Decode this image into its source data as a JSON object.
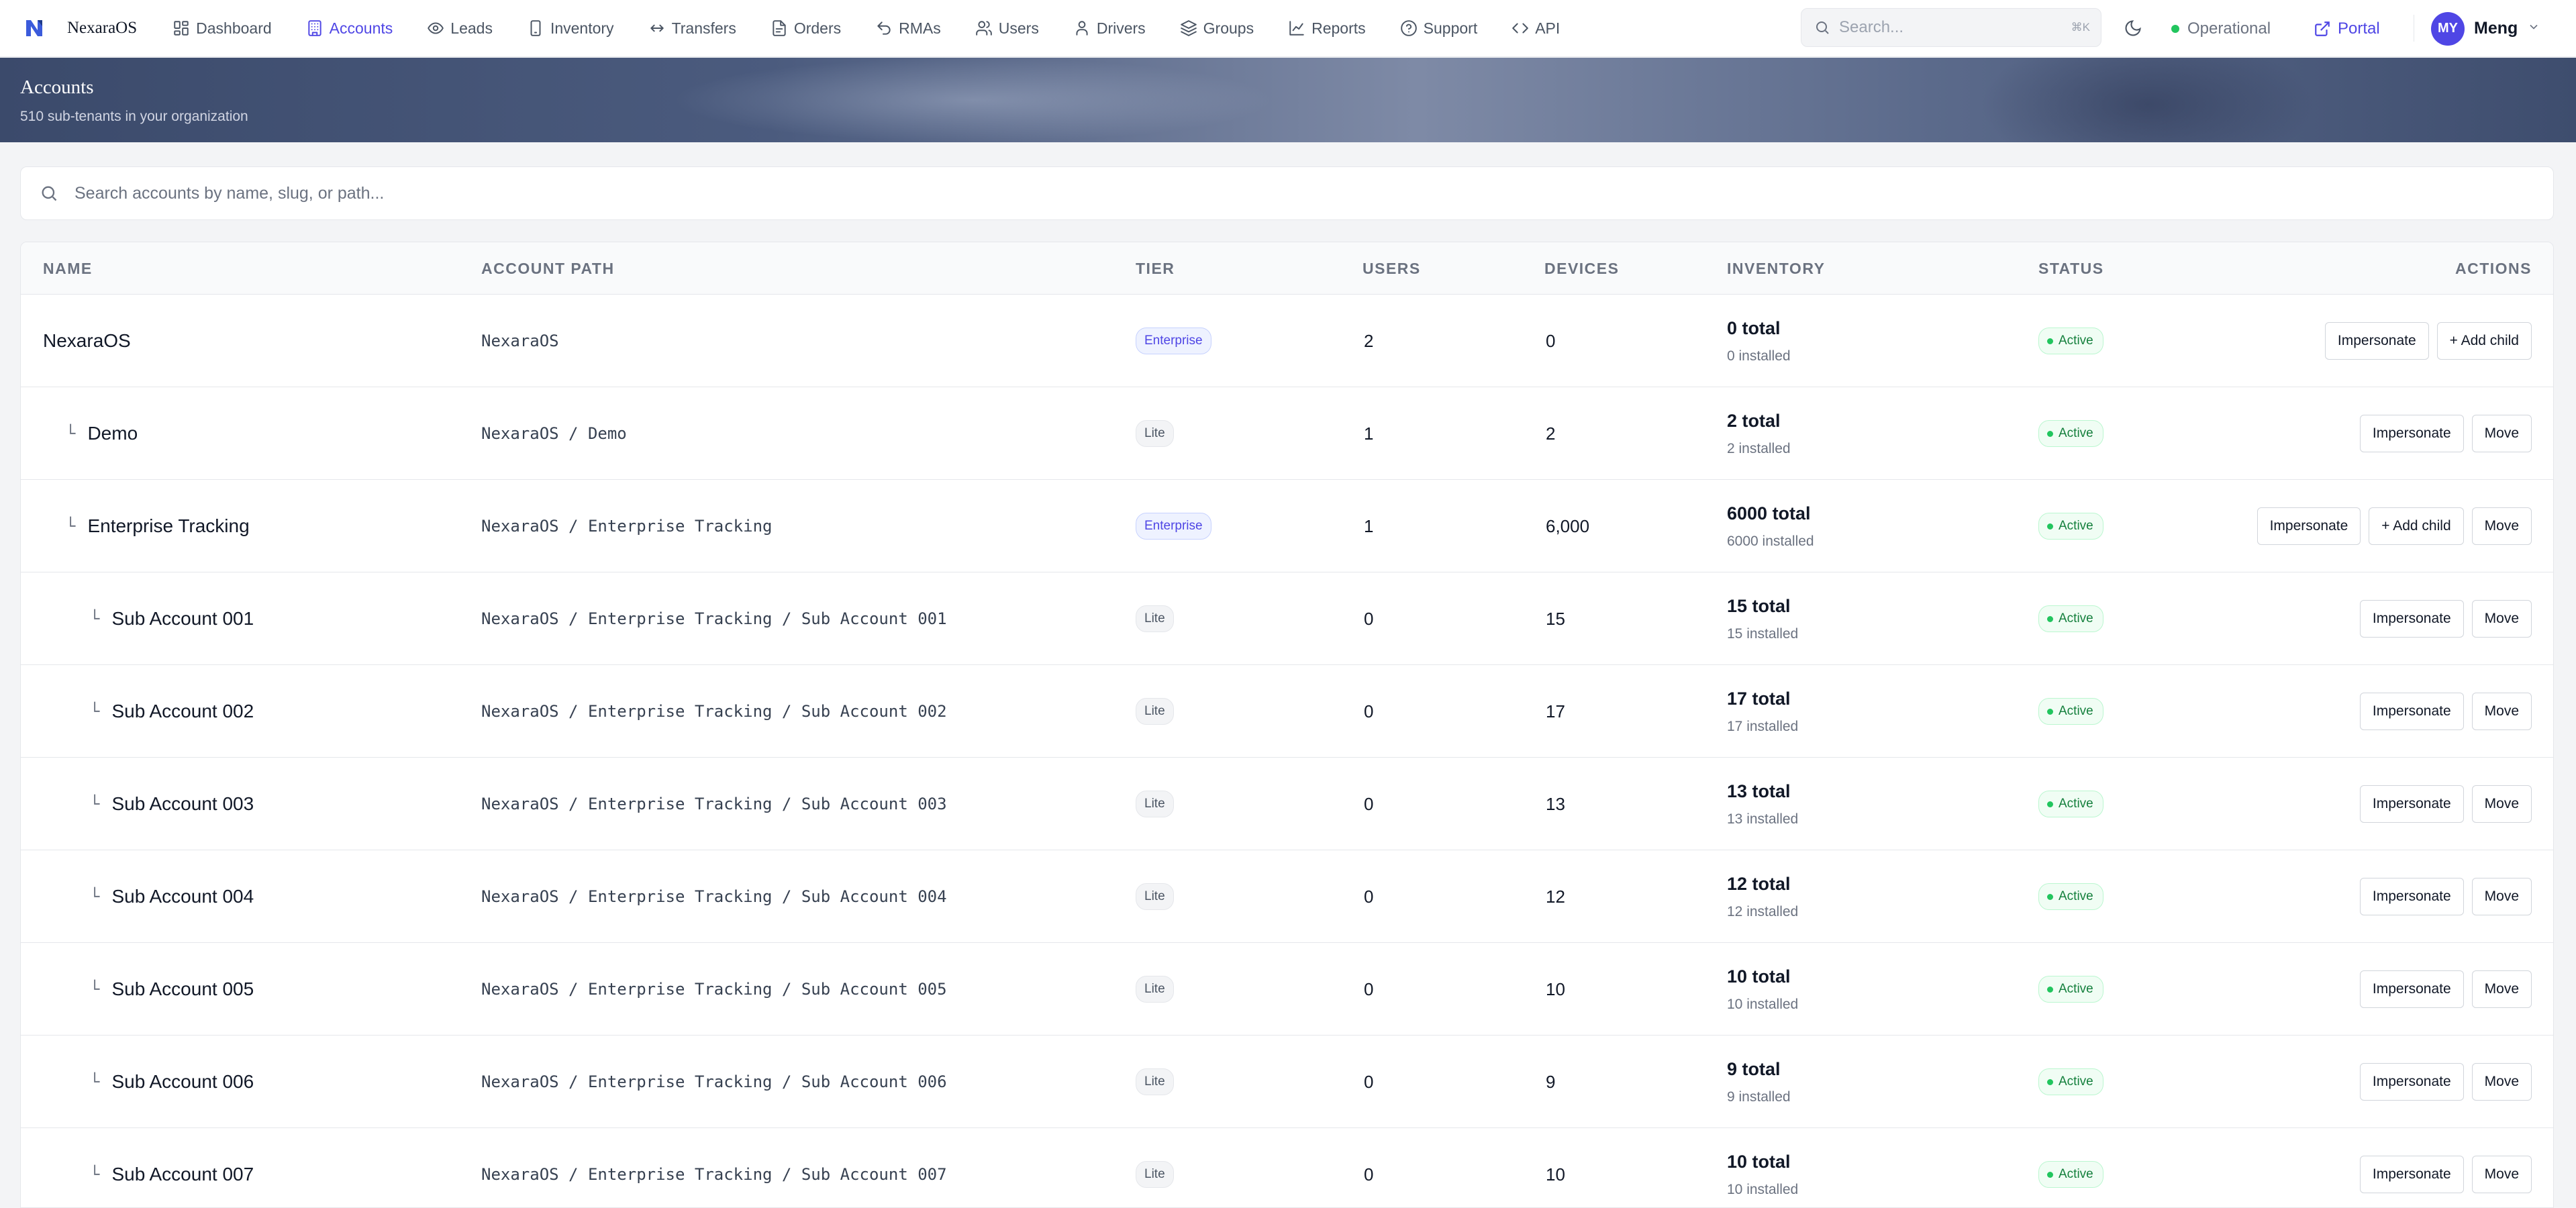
{
  "brand": {
    "name": "NexaraOS"
  },
  "nav": [
    {
      "label": "Dashboard",
      "icon": "dashboard-icon",
      "active": false
    },
    {
      "label": "Accounts",
      "icon": "building-icon",
      "active": true
    },
    {
      "label": "Leads",
      "icon": "eye-icon",
      "active": false
    },
    {
      "label": "Inventory",
      "icon": "device-icon",
      "active": false
    },
    {
      "label": "Transfers",
      "icon": "arrows-icon",
      "active": false
    },
    {
      "label": "Orders",
      "icon": "document-icon",
      "active": false
    },
    {
      "label": "RMAs",
      "icon": "undo-icon",
      "active": false
    },
    {
      "label": "Users",
      "icon": "users-icon",
      "active": false
    },
    {
      "label": "Drivers",
      "icon": "person-icon",
      "active": false
    },
    {
      "label": "Groups",
      "icon": "layers-icon",
      "active": false
    },
    {
      "label": "Reports",
      "icon": "chart-icon",
      "active": false
    },
    {
      "label": "Support",
      "icon": "help-icon",
      "active": false
    },
    {
      "label": "API",
      "icon": "code-icon",
      "active": false
    }
  ],
  "topbar": {
    "search_placeholder": "Search...",
    "search_shortcut": "⌘K",
    "status": "Operational",
    "portal": "Portal",
    "user_initials": "MY",
    "user_name": "Meng"
  },
  "banner": {
    "title": "Accounts",
    "subtitle": "510 sub-tenants in your organization"
  },
  "search": {
    "placeholder": "Search accounts by name, slug, or path..."
  },
  "table": {
    "headers": {
      "name": "NAME",
      "path": "ACCOUNT PATH",
      "tier": "TIER",
      "users": "USERS",
      "devices": "DEVICES",
      "inventory": "INVENTORY",
      "status": "STATUS",
      "actions": "ACTIONS"
    },
    "rows": [
      {
        "name": "NexaraOS",
        "depth": 0,
        "path": "NexaraOS",
        "tier": "Enterprise",
        "users": "2",
        "devices": "0",
        "inv_total": "0 total",
        "inv_installed": "0 installed",
        "status": "Active",
        "actions": [
          "Impersonate",
          "+ Add child"
        ]
      },
      {
        "name": "Demo",
        "depth": 1,
        "path": "NexaraOS / Demo",
        "tier": "Lite",
        "users": "1",
        "devices": "2",
        "inv_total": "2 total",
        "inv_installed": "2 installed",
        "status": "Active",
        "actions": [
          "Impersonate",
          "Move"
        ]
      },
      {
        "name": "Enterprise Tracking",
        "depth": 1,
        "path": "NexaraOS / Enterprise Tracking",
        "tier": "Enterprise",
        "users": "1",
        "devices": "6,000",
        "inv_total": "6000 total",
        "inv_installed": "6000 installed",
        "status": "Active",
        "actions": [
          "Impersonate",
          "+ Add child",
          "Move"
        ]
      },
      {
        "name": "Sub Account 001",
        "depth": 2,
        "path": "NexaraOS / Enterprise Tracking / Sub Account 001",
        "tier": "Lite",
        "users": "0",
        "devices": "15",
        "inv_total": "15 total",
        "inv_installed": "15 installed",
        "status": "Active",
        "actions": [
          "Impersonate",
          "Move"
        ]
      },
      {
        "name": "Sub Account 002",
        "depth": 2,
        "path": "NexaraOS / Enterprise Tracking / Sub Account 002",
        "tier": "Lite",
        "users": "0",
        "devices": "17",
        "inv_total": "17 total",
        "inv_installed": "17 installed",
        "status": "Active",
        "actions": [
          "Impersonate",
          "Move"
        ]
      },
      {
        "name": "Sub Account 003",
        "depth": 2,
        "path": "NexaraOS / Enterprise Tracking / Sub Account 003",
        "tier": "Lite",
        "users": "0",
        "devices": "13",
        "inv_total": "13 total",
        "inv_installed": "13 installed",
        "status": "Active",
        "actions": [
          "Impersonate",
          "Move"
        ]
      },
      {
        "name": "Sub Account 004",
        "depth": 2,
        "path": "NexaraOS / Enterprise Tracking / Sub Account 004",
        "tier": "Lite",
        "users": "0",
        "devices": "12",
        "inv_total": "12 total",
        "inv_installed": "12 installed",
        "status": "Active",
        "actions": [
          "Impersonate",
          "Move"
        ]
      },
      {
        "name": "Sub Account 005",
        "depth": 2,
        "path": "NexaraOS / Enterprise Tracking / Sub Account 005",
        "tier": "Lite",
        "users": "0",
        "devices": "10",
        "inv_total": "10 total",
        "inv_installed": "10 installed",
        "status": "Active",
        "actions": [
          "Impersonate",
          "Move"
        ]
      },
      {
        "name": "Sub Account 006",
        "depth": 2,
        "path": "NexaraOS / Enterprise Tracking / Sub Account 006",
        "tier": "Lite",
        "users": "0",
        "devices": "9",
        "inv_total": "9 total",
        "inv_installed": "9 installed",
        "status": "Active",
        "actions": [
          "Impersonate",
          "Move"
        ]
      },
      {
        "name": "Sub Account 007",
        "depth": 2,
        "path": "NexaraOS / Enterprise Tracking / Sub Account 007",
        "tier": "Lite",
        "users": "0",
        "devices": "10",
        "inv_total": "10 total",
        "inv_installed": "10 installed",
        "status": "Active",
        "actions": [
          "Impersonate",
          "Move"
        ]
      }
    ]
  },
  "colors": {
    "accent": "#4f46e5",
    "status_ok": "#22c55e",
    "banner": "#4b5b7e"
  }
}
